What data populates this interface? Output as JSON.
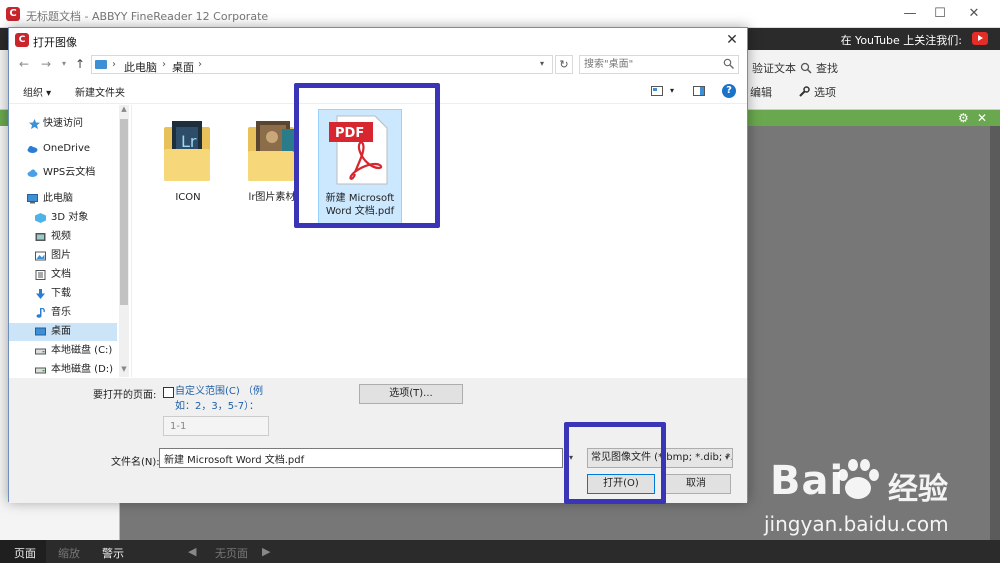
{
  "app": {
    "title": "无标题文档 - ABBYY FineReader 12 Corporate",
    "logo_letter": "C",
    "youtube_text": "在 YouTube 上关注我们:",
    "window_controls": [
      "—",
      "☐",
      "✕"
    ],
    "ribbon": {
      "verify": "验证文本",
      "find": "查找",
      "edit": "编辑",
      "options": "选项"
    },
    "status": {
      "page": "页面",
      "zoom": "缩放",
      "warning": "警示",
      "no_page": "无页面"
    }
  },
  "watermark": {
    "brand": "Bai",
    "cn": "经验",
    "url": "jingyan.baidu.com"
  },
  "dialog": {
    "title": "打开图像",
    "close": "✕",
    "breadcrumb": [
      "此电脑",
      "桌面"
    ],
    "search_placeholder": "搜索\"桌面\"",
    "toolbar": {
      "organize": "组织 ▾",
      "new_folder": "新建文件夹"
    },
    "help": "?",
    "nav_items": [
      {
        "label": "快速访问",
        "icon": "star-icon"
      },
      {
        "label": "OneDrive",
        "icon": "cloud-icon"
      },
      {
        "label": "WPS云文档",
        "icon": "wps-cloud-icon"
      },
      {
        "label": "此电脑",
        "icon": "computer-icon"
      },
      {
        "label": "3D 对象",
        "icon": "cube-icon"
      },
      {
        "label": "视频",
        "icon": "video-icon"
      },
      {
        "label": "图片",
        "icon": "picture-icon"
      },
      {
        "label": "文档",
        "icon": "document-icon"
      },
      {
        "label": "下载",
        "icon": "download-icon"
      },
      {
        "label": "音乐",
        "icon": "music-icon"
      },
      {
        "label": "桌面",
        "icon": "desktop-icon"
      },
      {
        "label": "本地磁盘 (C:)",
        "icon": "drive-icon"
      },
      {
        "label": "本地磁盘 (D:)",
        "icon": "drive-icon"
      }
    ],
    "files": [
      {
        "name": "ICON",
        "type": "folder"
      },
      {
        "name": "lr图片素材",
        "type": "folder"
      },
      {
        "name": "新建 Microsoft Word 文档.pdf",
        "type": "pdf",
        "badge": "PDF"
      }
    ],
    "pages_label": "要打开的页面:",
    "custom_range_label": "自定义范围(C) （例如：2，3，5-7）：",
    "range_value": "1-1",
    "options_button": "选项(T)...",
    "filename_label": "文件名(N):",
    "filename_value": "新建 Microsoft Word 文档.pdf",
    "filetype_value": "常见图像文件 (*.bmp; *.dib; *.",
    "open_button": "打开(O)",
    "cancel_button": "取消",
    "highlight_color": "#3a34b7"
  }
}
